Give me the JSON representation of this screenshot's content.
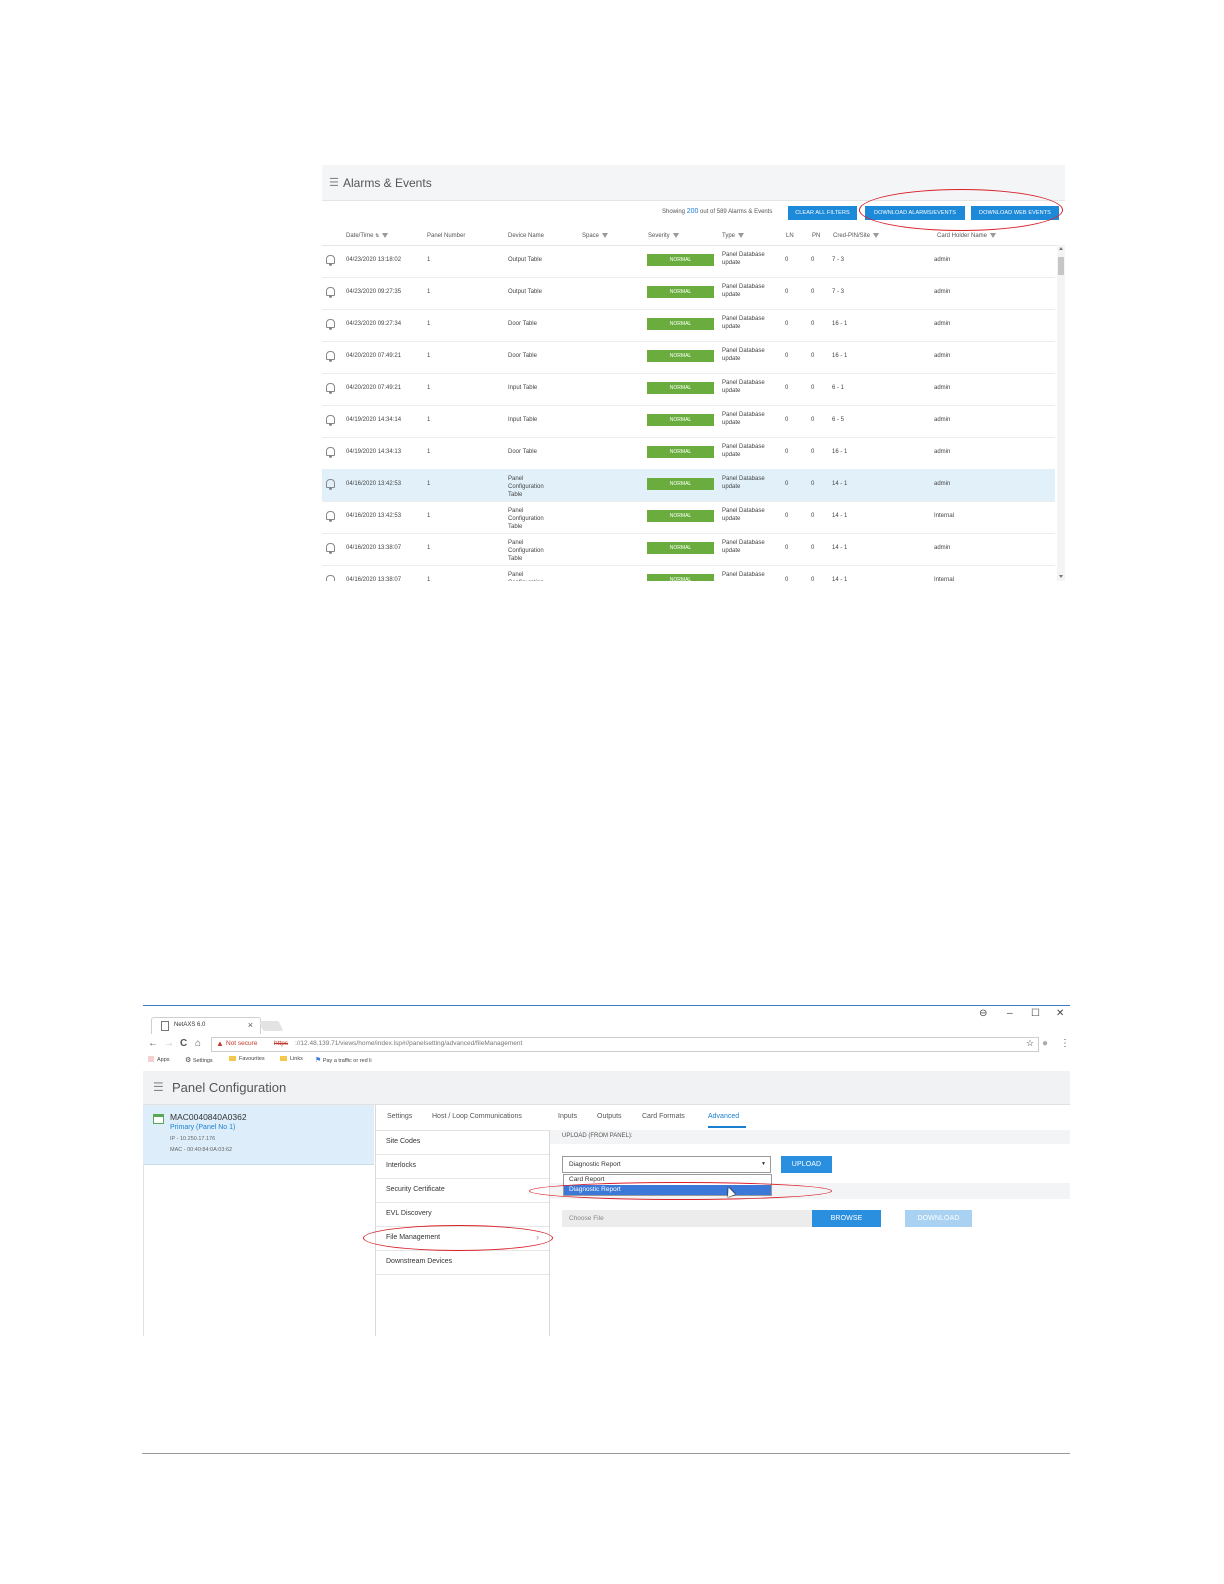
{
  "alarms": {
    "title": "Alarms & Events",
    "showing_prefix": "Showing",
    "showing_count": "200",
    "showing_suffix": "out of 589 Alarms & Events",
    "buttons": {
      "clear_filters": "CLEAR ALL FILTERS",
      "download_alarms": "DOWNLOAD ALARMS/EVENTS",
      "download_web": "DOWNLOAD WEB EVENTS"
    },
    "columns": {
      "datetime": "Date/Time",
      "panel": "Panel Number",
      "device": "Device Name",
      "space": "Space",
      "severity": "Severity",
      "type": "Type",
      "ln": "LN",
      "pn": "PN",
      "cred": "Cred-PIN/Site",
      "holder": "Card Holder Name"
    },
    "rows": [
      {
        "datetime": "04/23/2020 13:18:02",
        "panel": "1",
        "device": "Output Table",
        "severity": "NORMAL",
        "type": "Panel Database update",
        "ln": "0",
        "pn": "0",
        "cred": "7 - 3",
        "holder": "admin"
      },
      {
        "datetime": "04/23/2020 09:27:35",
        "panel": "1",
        "device": "Output Table",
        "severity": "NORMAL",
        "type": "Panel Database update",
        "ln": "0",
        "pn": "0",
        "cred": "7 - 3",
        "holder": "admin"
      },
      {
        "datetime": "04/23/2020 09:27:34",
        "panel": "1",
        "device": "Door Table",
        "severity": "NORMAL",
        "type": "Panel Database update",
        "ln": "0",
        "pn": "0",
        "cred": "16 - 1",
        "holder": "admin"
      },
      {
        "datetime": "04/20/2020 07:49:21",
        "panel": "1",
        "device": "Door Table",
        "severity": "NORMAL",
        "type": "Panel Database update",
        "ln": "0",
        "pn": "0",
        "cred": "16 - 1",
        "holder": "admin"
      },
      {
        "datetime": "04/20/2020 07:49:21",
        "panel": "1",
        "device": "Input Table",
        "severity": "NORMAL",
        "type": "Panel Database update",
        "ln": "0",
        "pn": "0",
        "cred": "6 - 1",
        "holder": "admin"
      },
      {
        "datetime": "04/19/2020 14:34:14",
        "panel": "1",
        "device": "Input Table",
        "severity": "NORMAL",
        "type": "Panel Database update",
        "ln": "0",
        "pn": "0",
        "cred": "6 - 5",
        "holder": "admin"
      },
      {
        "datetime": "04/19/2020 14:34:13",
        "panel": "1",
        "device": "Door Table",
        "severity": "NORMAL",
        "type": "Panel Database update",
        "ln": "0",
        "pn": "0",
        "cred": "16 - 1",
        "holder": "admin"
      },
      {
        "datetime": "04/16/2020 13:42:53",
        "panel": "1",
        "device": "Panel Configuration Table",
        "severity": "NORMAL",
        "type": "Panel Database update",
        "ln": "0",
        "pn": "0",
        "cred": "14 - 1",
        "holder": "admin"
      },
      {
        "datetime": "04/16/2020 13:42:53",
        "panel": "1",
        "device": "Panel Configuration Table",
        "severity": "NORMAL",
        "type": "Panel Database update",
        "ln": "0",
        "pn": "0",
        "cred": "14 - 1",
        "holder": "Internal"
      },
      {
        "datetime": "04/16/2020 13:38:07",
        "panel": "1",
        "device": "Panel Configuration Table",
        "severity": "NORMAL",
        "type": "Panel Database update",
        "ln": "0",
        "pn": "0",
        "cred": "14 - 1",
        "holder": "admin"
      },
      {
        "datetime": "04/16/2020 13:38:07",
        "panel": "1",
        "device": "Panel Configuration",
        "severity": "NORMAL",
        "type": "Panel Database",
        "ln": "0",
        "pn": "0",
        "cred": "14 - 1",
        "holder": "Internal"
      }
    ],
    "selected_row": 7,
    "colors": {
      "accent": "#1c8ad8",
      "normal": "#6aad3e",
      "highlight": "#d9202a"
    }
  },
  "browser": {
    "tab_title": "NetAXS 6.0",
    "tab_close": "×",
    "window_controls": {
      "profile": "⊖",
      "minimize": "–",
      "maximize": "☐",
      "close": "✕"
    },
    "nav": {
      "back": "←",
      "forward": "→",
      "reload": "C",
      "home": "⌂"
    },
    "url": {
      "warning": "Not secure",
      "scheme": "https",
      "rest": "://12.48.139.71/views/home/index.lsp#//panelsetting/advanced/fileManagement"
    },
    "bookmarks": [
      "Apps",
      "Settings",
      "Favourites",
      "Links",
      "Pay a traffic or red li"
    ]
  },
  "panel_config": {
    "title": "Panel Configuration",
    "panel": {
      "name": "MAC0040840A0362",
      "subtitle": "Primary (Panel No 1)",
      "ip": "IP - 10.250.17.176",
      "mac": "MAC - 00:40:84:0A:03:62"
    },
    "tabs": [
      "Settings",
      "Host / Loop Communications",
      "Inputs",
      "Outputs",
      "Card Formats",
      "Advanced"
    ],
    "active_tab": "Advanced",
    "menu": [
      "Site Codes",
      "Interlocks",
      "Security Certificate",
      "EVL Discovery",
      "File Management",
      "Downstream Devices"
    ],
    "active_menu": "File Management",
    "upload_header": "UPLOAD (FROM PANEL):",
    "report_select": "Diagnostic Report",
    "report_options": [
      "Card Report",
      "Diagnostic Report"
    ],
    "upload_btn": "UPLOAD",
    "choose_file": "Choose File",
    "browse_btn": "BROWSE",
    "download_btn": "DOWNLOAD"
  }
}
